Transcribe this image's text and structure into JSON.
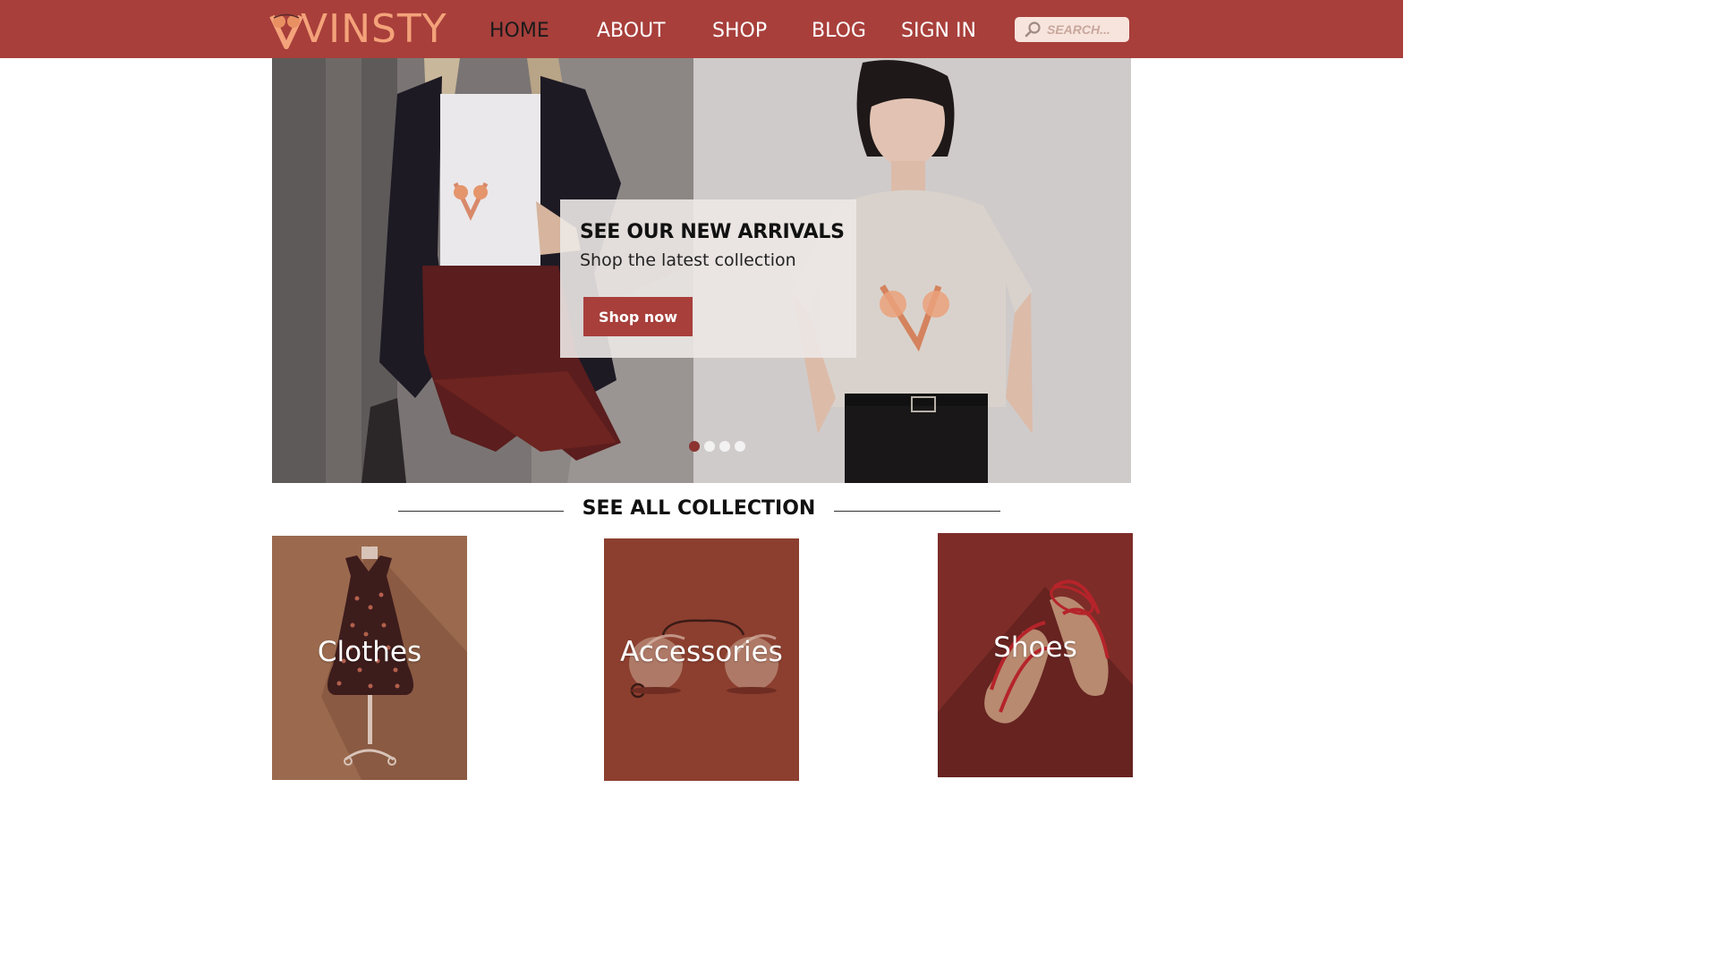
{
  "brand": {
    "name": "VINSTY",
    "logo_color": "#f4a27a"
  },
  "colors": {
    "header": "#a83f3b",
    "button": "#a83f3b",
    "active_nav": "#1b1b1b"
  },
  "nav": [
    {
      "label": "HOME",
      "active": true
    },
    {
      "label": "ABOUT",
      "active": false
    },
    {
      "label": "SHOP",
      "active": false
    },
    {
      "label": "BLOG",
      "active": false
    },
    {
      "label": "SIGN IN",
      "active": false
    }
  ],
  "search": {
    "placeholder": "SEARCH...",
    "icon": "search-icon"
  },
  "hero": {
    "title": "SEE OUR NEW ARRIVALS",
    "subtitle": "Shop the latest collection",
    "button": "Shop now",
    "slides_total": 4,
    "active_slide": 1
  },
  "collection": {
    "title": "SEE ALL COLLECTION",
    "categories": [
      {
        "label": "Clothes",
        "color": "#9b6a4e",
        "icon": "dress-icon"
      },
      {
        "label": "Accessories",
        "color": "#8c3f2f",
        "icon": "sunglasses-icon"
      },
      {
        "label": "Shoes",
        "color": "#7d2c28",
        "icon": "sandals-icon"
      }
    ]
  }
}
